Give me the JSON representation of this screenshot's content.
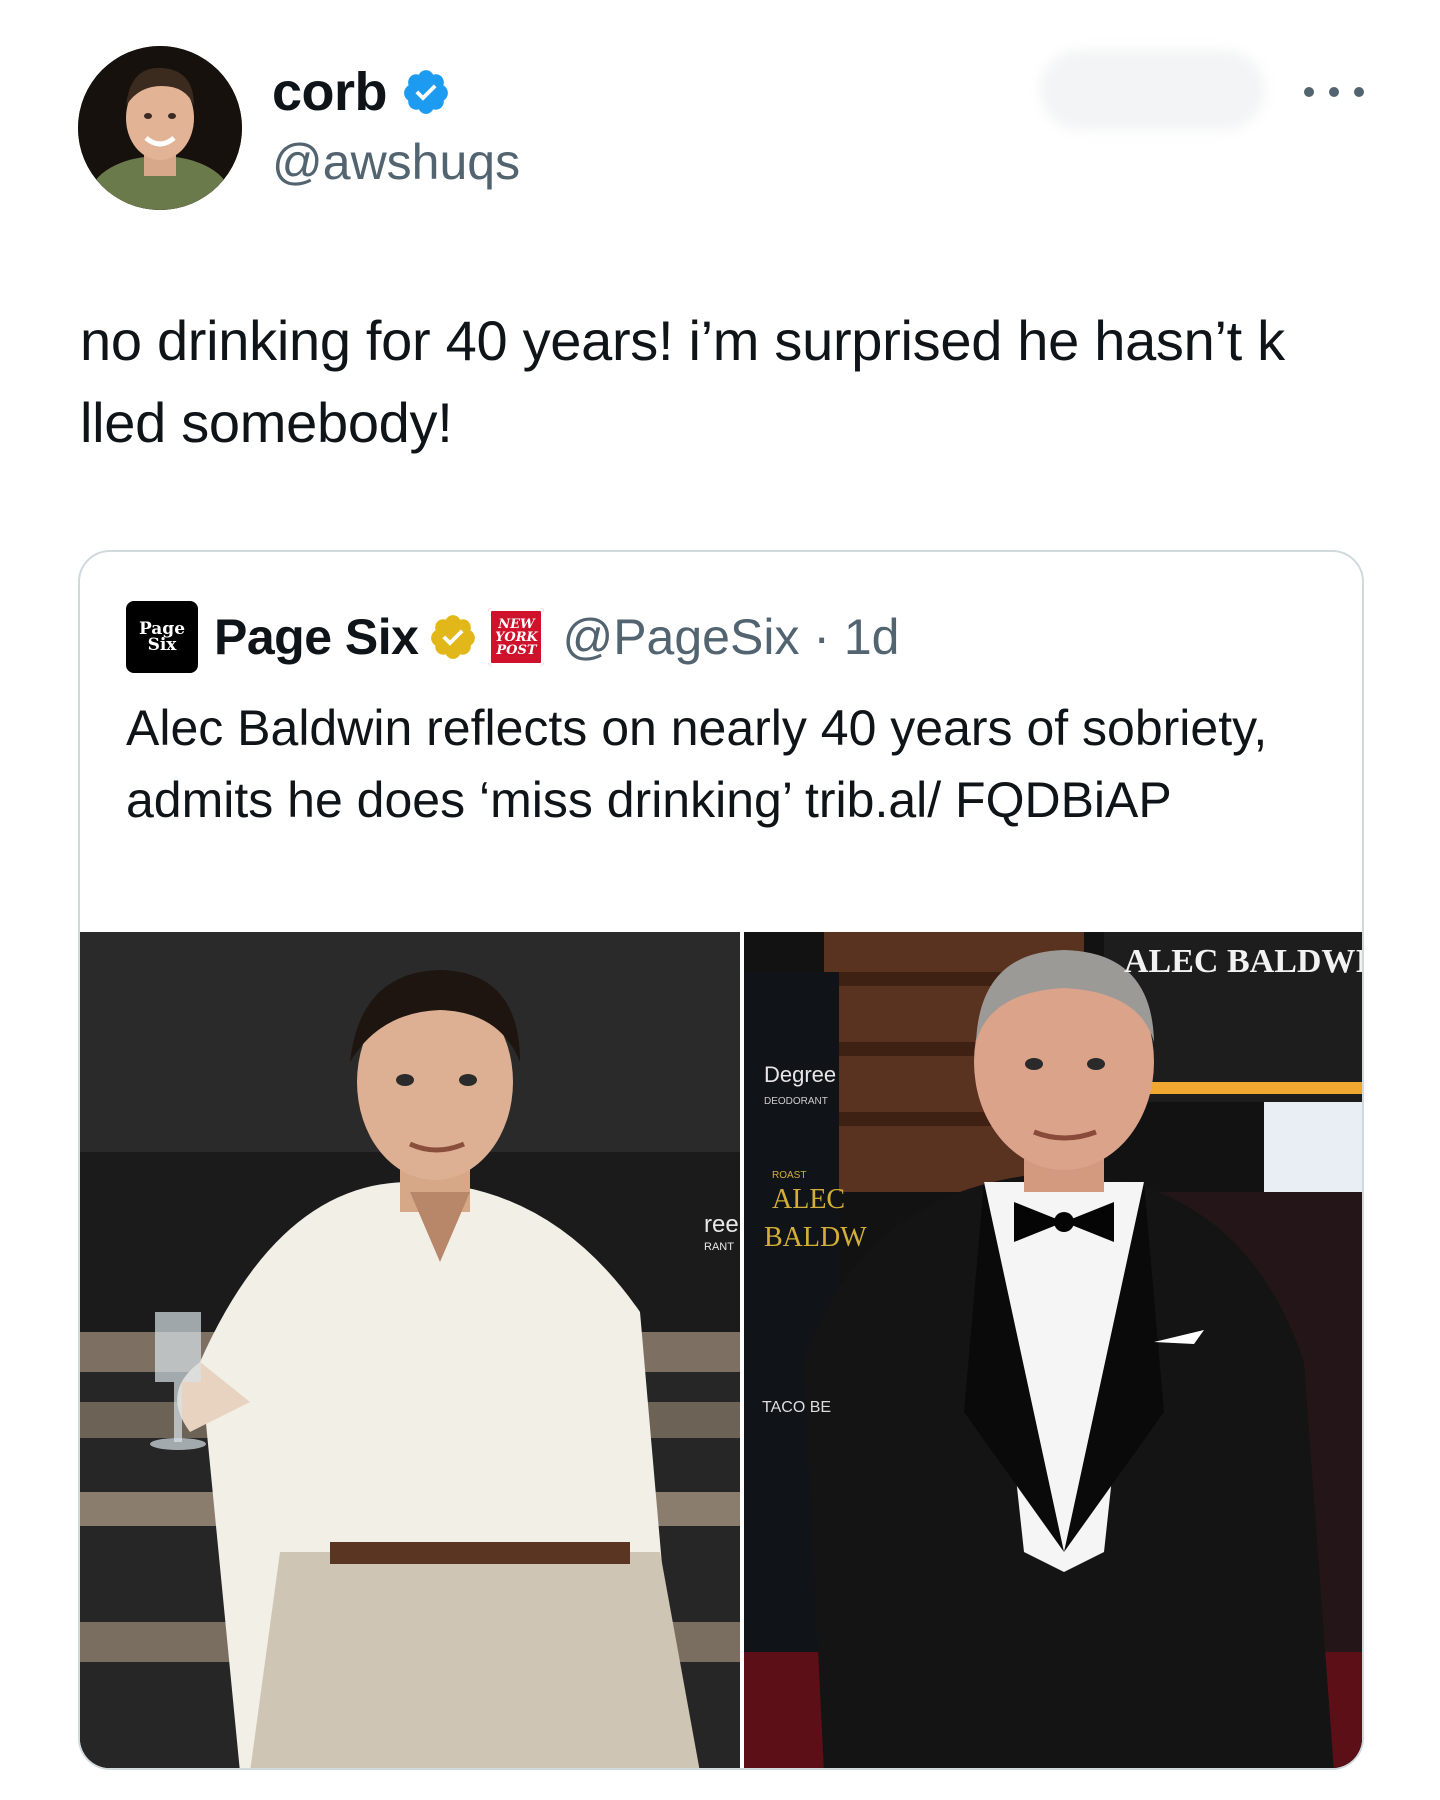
{
  "author": {
    "name": "corb",
    "handle": "@awshuqs",
    "verified": true
  },
  "tweet": {
    "text": "no drinking for 40 years! i’m surprised he hasn’t k lled somebody!"
  },
  "quote": {
    "logo_text_top": "Page",
    "logo_text_bottom": "Six",
    "name": "Page Six",
    "affiliate_badge": [
      "NEW",
      "YORK",
      "POST"
    ],
    "handle_and_time": "@PageSix · 1d",
    "text": "Alec Baldwin reflects on nearly 40 years of sobriety, admits he does ‘miss drinking’ trib.al/ FQDBiAP",
    "photo_texts": {
      "marquee": "ALEC BALDWIN",
      "sponsor_1": "Degree",
      "sponsor_1_sub": "DEODORANT",
      "roast_small": "ROAST",
      "roast_line1": "ALEC",
      "roast_line2": "BALDW",
      "sponsor_2": "TACO BE",
      "edge_1": "ree",
      "edge_2": "RANT"
    }
  },
  "colors": {
    "verified_blue": "#1d9bf0",
    "verified_gold": "#e2b719",
    "text_primary": "#0f1419",
    "text_secondary": "#536471",
    "border": "#cfd9de",
    "nypost_red": "#d0112b"
  }
}
